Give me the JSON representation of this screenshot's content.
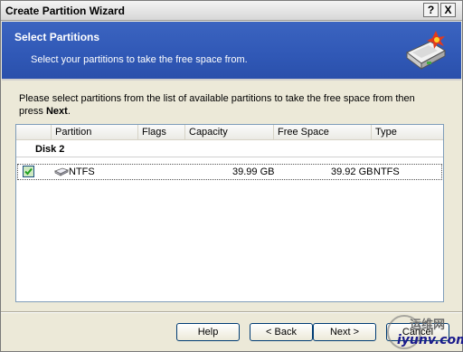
{
  "window": {
    "title": "Create Partition Wizard",
    "help_glyph": "?",
    "close_glyph": "X"
  },
  "header": {
    "title": "Select Partitions",
    "subtitle": "Select your partitions to take the free space from.",
    "icon": "hard-drive-wizard-icon",
    "background_color": "#3058b6"
  },
  "instructions": {
    "text_before": "Please select partitions from the list of available partitions to take the free space from then press ",
    "bold_word": "Next",
    "text_after": "."
  },
  "list": {
    "columns": [
      "Partition",
      "Flags",
      "Capacity",
      "Free Space",
      "Type"
    ],
    "group": "Disk 2",
    "rows": [
      {
        "checked": true,
        "partition": "NTFS",
        "flags": "",
        "capacity": "39.99 GB",
        "free_space": "39.92 GB",
        "type": "NTFS"
      }
    ]
  },
  "buttons": {
    "help": "Help",
    "back": "< Back",
    "next": "Next >",
    "cancel": "Cancel"
  },
  "watermark": {
    "line1": "运维网",
    "line2": "iyunv.com"
  }
}
